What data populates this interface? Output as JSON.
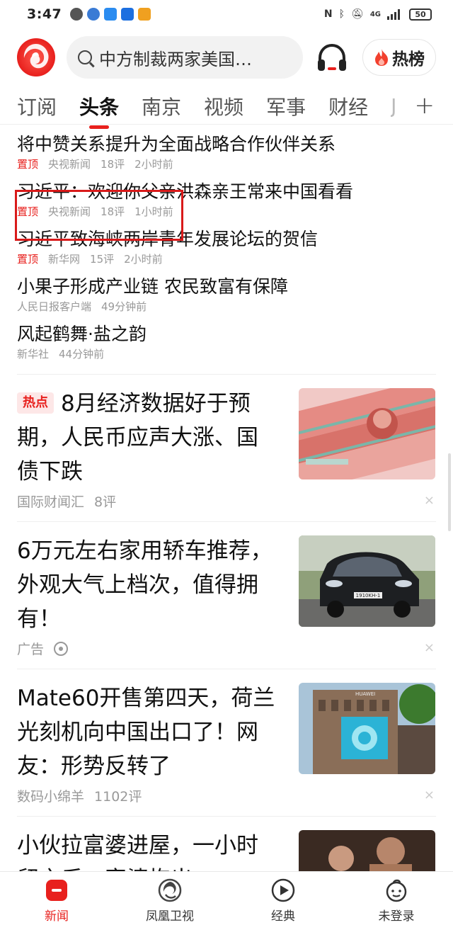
{
  "status_bar": {
    "time": "3:47",
    "network": "4G",
    "battery": "50"
  },
  "header": {
    "search_placeholder": "中方制裁两家美国…",
    "hot_label": "热榜"
  },
  "tabs": [
    {
      "label": "订阅",
      "active": false
    },
    {
      "label": "头条",
      "active": true
    },
    {
      "label": "南京",
      "active": false
    },
    {
      "label": "视频",
      "active": false
    },
    {
      "label": "军事",
      "active": false
    },
    {
      "label": "财经",
      "active": false
    },
    {
      "label": "J",
      "active": false
    }
  ],
  "plus_label": "+",
  "top_news": [
    {
      "title": "将中赞关系提升为全面战略合作伙伴关系",
      "pin": "置顶",
      "source": "央视新闻",
      "comments": "18评",
      "time": "2小时前"
    },
    {
      "title": "习近平：欢迎你父亲洪森亲王常来中国看看",
      "pin": "置顶",
      "source": "央视新闻",
      "comments": "18评",
      "time": "1小时前"
    },
    {
      "title": "习近平致海峡两岸青年发展论坛的贺信",
      "pin": "置顶",
      "source": "新华网",
      "comments": "15评",
      "time": "2小时前"
    },
    {
      "title": "小果子形成产业链 农民致富有保障",
      "pin": "",
      "source": "人民日报客户端",
      "comments": "",
      "time": "49分钟前"
    },
    {
      "title": "风起鹤舞·盐之韵",
      "pin": "",
      "source": "新华社",
      "comments": "",
      "time": "44分钟前"
    }
  ],
  "feed": [
    {
      "badge": "热点",
      "title": "8月经济数据好于预期，人民币应声大涨、国债下跌",
      "source": "国际财闻汇",
      "comments": "8评",
      "image": "rmb-banknotes"
    },
    {
      "badge": "",
      "title": "6万元左右家用轿车推荐，外观大气上档次，值得拥有！",
      "source": "广告",
      "comments": "",
      "image": "black-car",
      "plate": "1910KH-1"
    },
    {
      "badge": "",
      "title": "Mate60开售第四天，荷兰光刻机向中国出口了！网友：形势反转了",
      "source": "数码小绵羊",
      "comments": "1102评",
      "image": "huawei-store",
      "sign": "HUAWEI"
    },
    {
      "badge": "",
      "title": "小伙拉富婆进屋，一小时留之后，富婆抱出",
      "source": "",
      "comments": "",
      "image": "drama-still"
    }
  ],
  "dismiss_glyph": "×",
  "bottom_nav": [
    {
      "label": "新闻",
      "icon": "news-icon",
      "active": true
    },
    {
      "label": "凤凰卫视",
      "icon": "phoenix-tv-icon",
      "active": false
    },
    {
      "label": "经典",
      "icon": "play-icon",
      "active": false
    },
    {
      "label": "未登录",
      "icon": "user-icon",
      "active": false
    }
  ],
  "colors": {
    "accent": "#e8201d",
    "text": "#111111",
    "meta": "#999999"
  }
}
